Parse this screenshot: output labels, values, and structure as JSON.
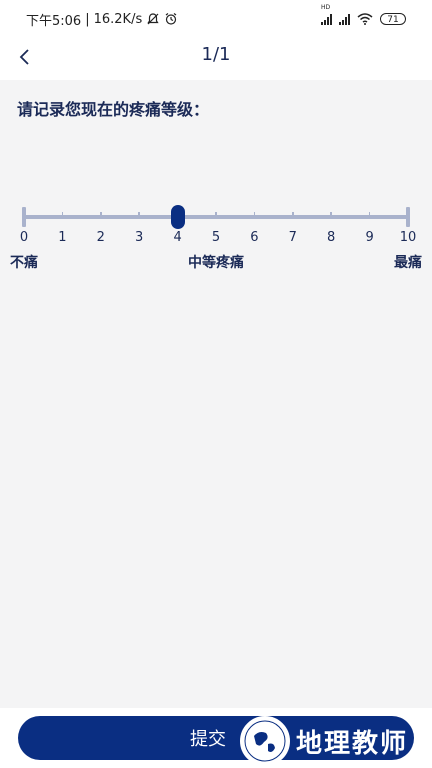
{
  "status_bar": {
    "time": "下午5:06",
    "speed": "16.2K/s",
    "battery": "71",
    "network_label": "HD"
  },
  "header": {
    "title": "1/1"
  },
  "question": {
    "prompt": "请记录您现在的疼痛等级："
  },
  "slider": {
    "min": 0,
    "max": 10,
    "value": 4,
    "ticks": [
      "0",
      "1",
      "2",
      "3",
      "4",
      "5",
      "6",
      "7",
      "8",
      "9",
      "10"
    ],
    "label_min": "不痛",
    "label_mid": "中等疼痛",
    "label_max": "最痛"
  },
  "footer": {
    "submit_label": "提交"
  },
  "watermark": {
    "text": "地理教师"
  },
  "colors": {
    "primary": "#0a2e82",
    "track": "#a9b2cc",
    "background": "#f4f4f5"
  }
}
